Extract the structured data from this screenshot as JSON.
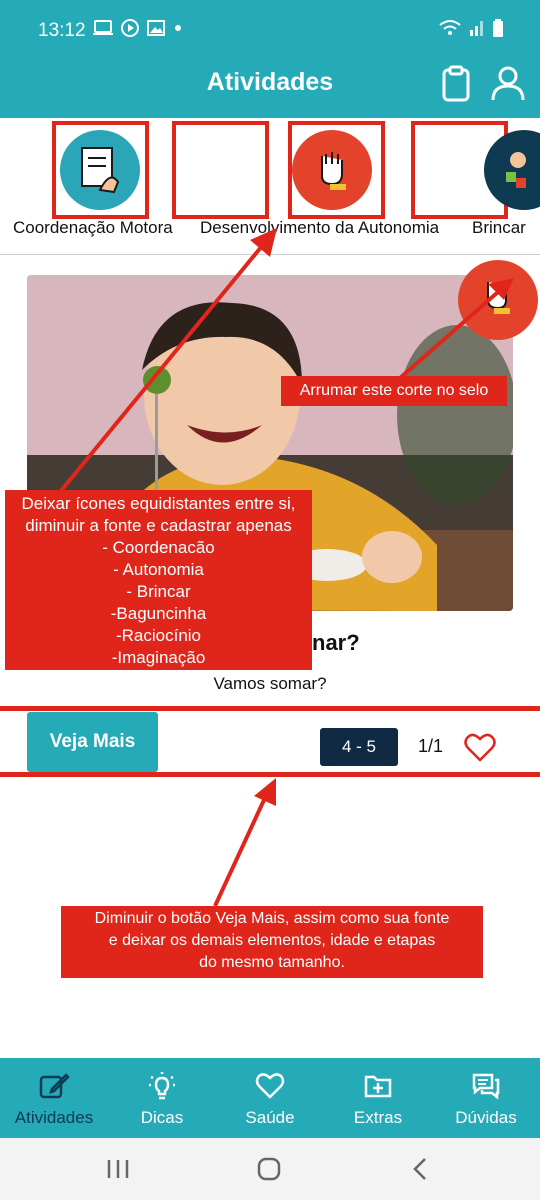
{
  "status_bar": {
    "time": "13:12"
  },
  "header": {
    "title": "Atividades",
    "icons": [
      "clipboard-icon",
      "user-icon"
    ]
  },
  "categories": [
    {
      "label": "Coordenação Motora",
      "icon": "hand-drawing-icon",
      "color": "#2aa6b8"
    },
    {
      "label": "Desenvolvimento da Autonomia",
      "icon": "hand-gesture-icon",
      "color": "#e4432b"
    },
    {
      "label": "Brincar",
      "icon": "child-blocks-icon",
      "color": "#0e3b52"
    }
  ],
  "card": {
    "title_tail": "nar?",
    "subtitle": "Vamos somar?",
    "see_more_label": "Veja Mais",
    "age_range": "4 - 5",
    "stage": "1/1"
  },
  "annotations": {
    "note_1": [
      "Deixar ícones equidistantes entre si,",
      "diminuir a fonte e cadastrar apenas",
      "- Coordenacão",
      "- Autonomia",
      "- Brincar",
      "-Baguncinha",
      "-Raciocínio",
      "-Imaginação"
    ],
    "note_2": "Arrumar este corte no selo",
    "note_3": [
      "Diminuir o botão Veja Mais, assim como sua fonte",
      "e deixar os demais elementos, idade e etapas",
      "do mesmo tamanho."
    ]
  },
  "bottom_nav": [
    {
      "label": "Atividades",
      "icon": "edit-icon",
      "active": true
    },
    {
      "label": "Dicas",
      "icon": "lightbulb-icon",
      "active": false
    },
    {
      "label": "Saúde",
      "icon": "heart-icon",
      "active": false
    },
    {
      "label": "Extras",
      "icon": "folder-plus-icon",
      "active": false
    },
    {
      "label": "Dúvidas",
      "icon": "chat-icon",
      "active": false
    }
  ],
  "colors": {
    "brand": "#25aab8",
    "annotation": "#e0261b",
    "dark": "#112a44"
  }
}
